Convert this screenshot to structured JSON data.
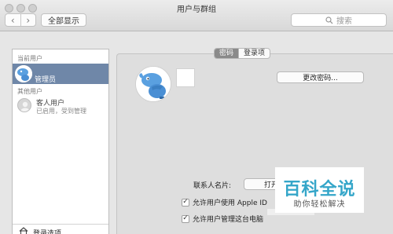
{
  "window": {
    "title": "用户与群组"
  },
  "toolbar": {
    "back_glyph": "‹",
    "forward_glyph": "›",
    "show_all": "全部显示",
    "search_placeholder": "搜索"
  },
  "sidebar": {
    "current_user_header": "当前用户",
    "current_user_name": "管理员",
    "other_users_header": "其他用户",
    "guest_name": "客人用户",
    "guest_status": "已启用，受到管理",
    "login_options": "登录选项"
  },
  "tabs": [
    {
      "label": "密码",
      "active": true
    },
    {
      "label": "登录项",
      "active": false
    }
  ],
  "main": {
    "change_password": "更改密码...",
    "contacts_card_label": "联系人名片:",
    "contacts_card_button": "打开",
    "checkbox_apple_id": "允许用户使用 Apple ID",
    "checkbox_admin": "允许用户管理这台电脑",
    "checkbox_apple_id_checked": true,
    "checkbox_admin_checked": true
  },
  "watermark": {
    "main": "百科全说",
    "sub": "助你轻松解决"
  },
  "colors": {
    "selection": "#6f87a8",
    "watermark": "#35a6c9",
    "avatar_bird": "#5aa0e0"
  }
}
